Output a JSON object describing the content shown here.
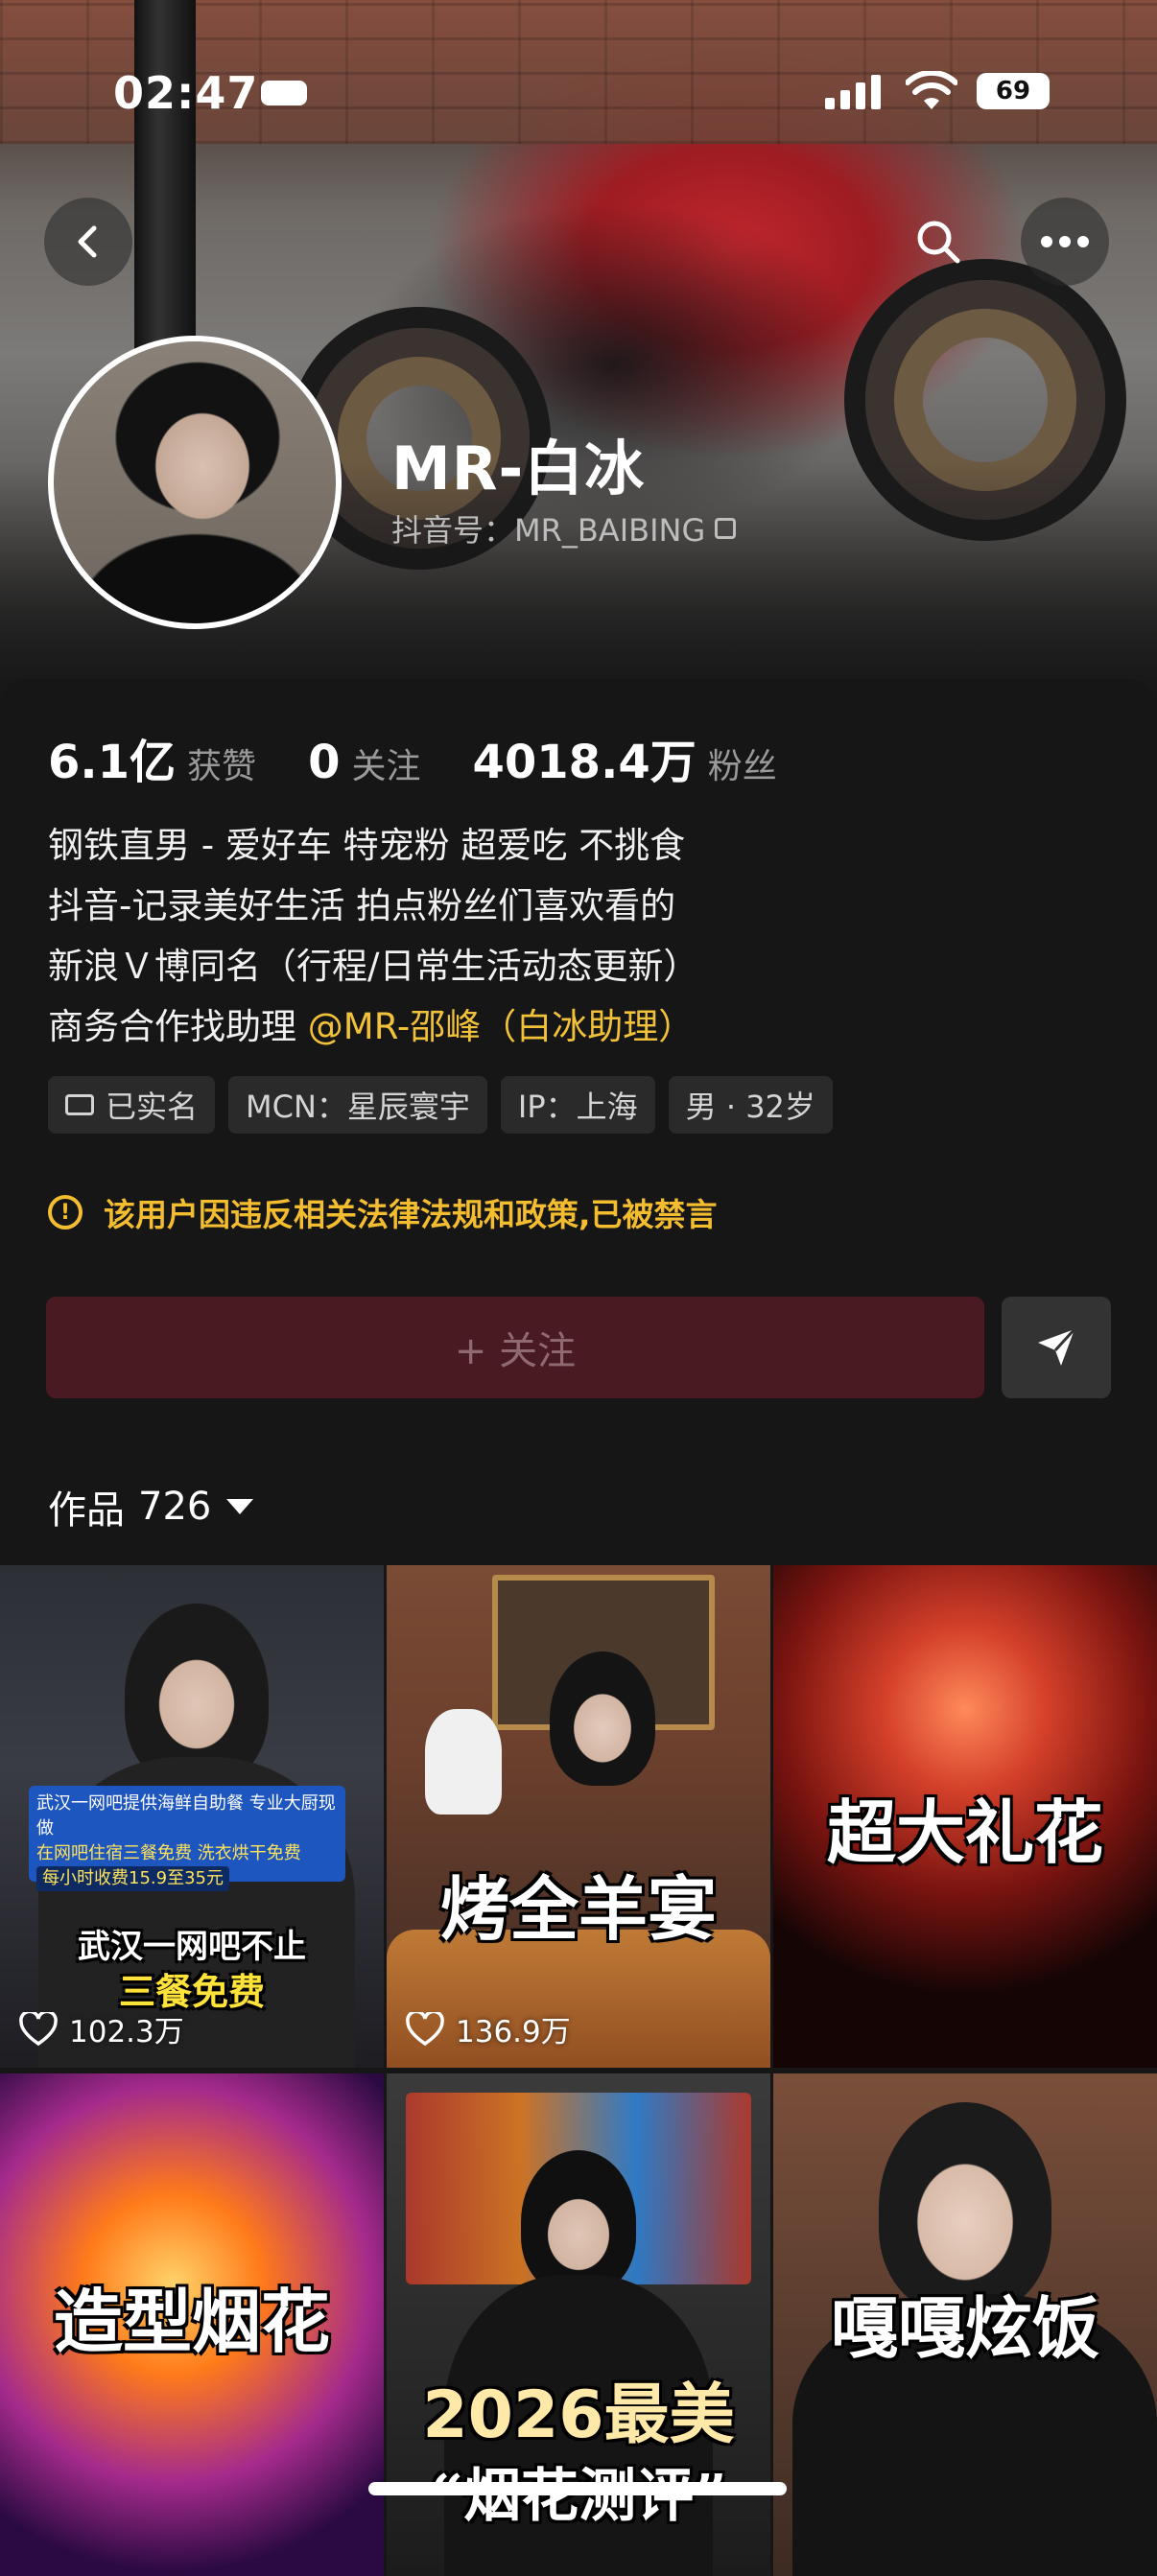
{
  "status": {
    "time": "02:47",
    "battery": "69"
  },
  "profile": {
    "name": "MR-白冰",
    "douyin_id": "抖音号：MR_BAIBING"
  },
  "stats": [
    {
      "value": "6.1亿",
      "label": "获赞"
    },
    {
      "value": "0",
      "label": "关注"
    },
    {
      "value": "4018.4万",
      "label": "粉丝"
    }
  ],
  "bio": {
    "line1": "钢铁直男 - 爱好车 特宠粉 超爱吃 不挑食",
    "line2": "抖音-记录美好生活 拍点粉丝们喜欢看的",
    "line3": "新浪Ｖ博同名（行程/日常生活动态更新）",
    "line4_prefix": "商务合作找助理 ",
    "line4_mention": "@MR-邵峰（白冰助理）"
  },
  "tags": [
    "已实名",
    "MCN：星辰寰宇",
    "IP：上海",
    "男 · 32岁"
  ],
  "warning": "该用户因违反相关法律法规和政策,已被禁言",
  "follow_label": "+ 关注",
  "works": {
    "label": "作品",
    "count": "726"
  },
  "videos": [
    {
      "caption_line1": "武汉一网吧不止",
      "caption_line2": "三餐免费",
      "news_title": "武汉一网吧提供海鲜自助餐 专业大厨现做",
      "news_sub": "在网吧住宿三餐免费 洗衣烘干免费",
      "news_price": "每小时收费15.9至35元",
      "likes": "102.3万"
    },
    {
      "caption": "烤全羊宴",
      "likes": "136.9万"
    },
    {
      "caption": "超大礼花",
      "likes": ""
    },
    {
      "caption": "造型烟花",
      "likes": ""
    },
    {
      "caption": "2026最美",
      "caption2": "“烟花测评”",
      "likes": ""
    },
    {
      "caption": "嘎嘎炫饭",
      "likes": ""
    }
  ],
  "colors": {
    "accent_yellow": "#f2c13a",
    "follow_bg": "#4a1a23",
    "background": "#161616"
  },
  "icons": {
    "back": "chevron-left-icon",
    "search": "search-icon",
    "more": "more-dots-icon",
    "share": "send-icon",
    "like": "heart-outline-icon",
    "warning": "alert-circle-icon",
    "verified": "id-card-icon"
  }
}
